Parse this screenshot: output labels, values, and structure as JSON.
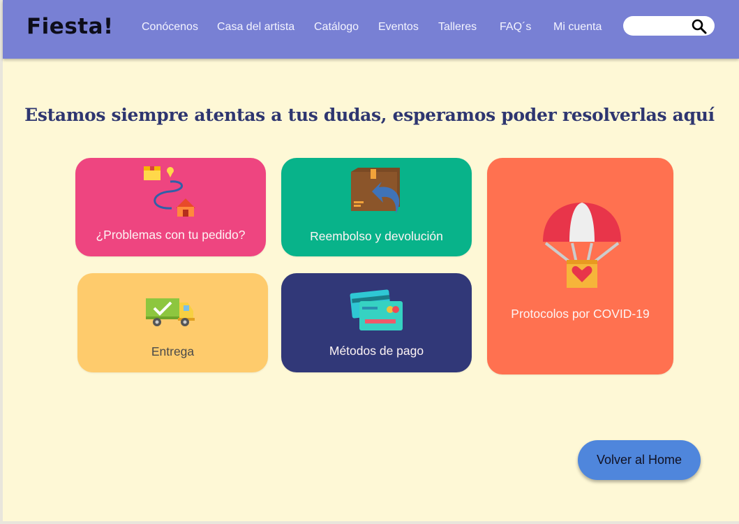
{
  "brand": {
    "logo_text": "Fiesta!"
  },
  "nav": {
    "items": [
      {
        "label": "Conócenos"
      },
      {
        "label": "Casa del artista"
      },
      {
        "label": "Catálogo"
      },
      {
        "label": "Eventos"
      },
      {
        "label": "Talleres"
      },
      {
        "label": "FAQ´s"
      },
      {
        "label": "Mi cuenta"
      }
    ],
    "search": {
      "placeholder": "",
      "value": "",
      "icon": "search-icon"
    }
  },
  "main": {
    "heading": "Estamos siempre atentas a tus dudas, esperamos poder resolverlas aquí",
    "cards": [
      {
        "label": "¿Problemas con tu pedido?",
        "icon": "delivery-route-icon",
        "color": "#ee4580"
      },
      {
        "label": "Reembolso y devolución",
        "icon": "return-box-icon",
        "color": "#08b38a"
      },
      {
        "label": "Protocolos por COVID-19",
        "icon": "parachute-heart-icon",
        "color": "#ff7150"
      },
      {
        "label": "Entrega",
        "icon": "delivery-truck-icon",
        "color": "#fecb6c"
      },
      {
        "label": "Métodos de pago",
        "icon": "credit-cards-icon",
        "color": "#313878"
      }
    ]
  },
  "home_button": {
    "label": "Volver al Home",
    "color": "#4f86dc"
  },
  "colors": {
    "navbar": "#7880d4",
    "background": "#fef8d6",
    "heading": "#2e3670"
  }
}
